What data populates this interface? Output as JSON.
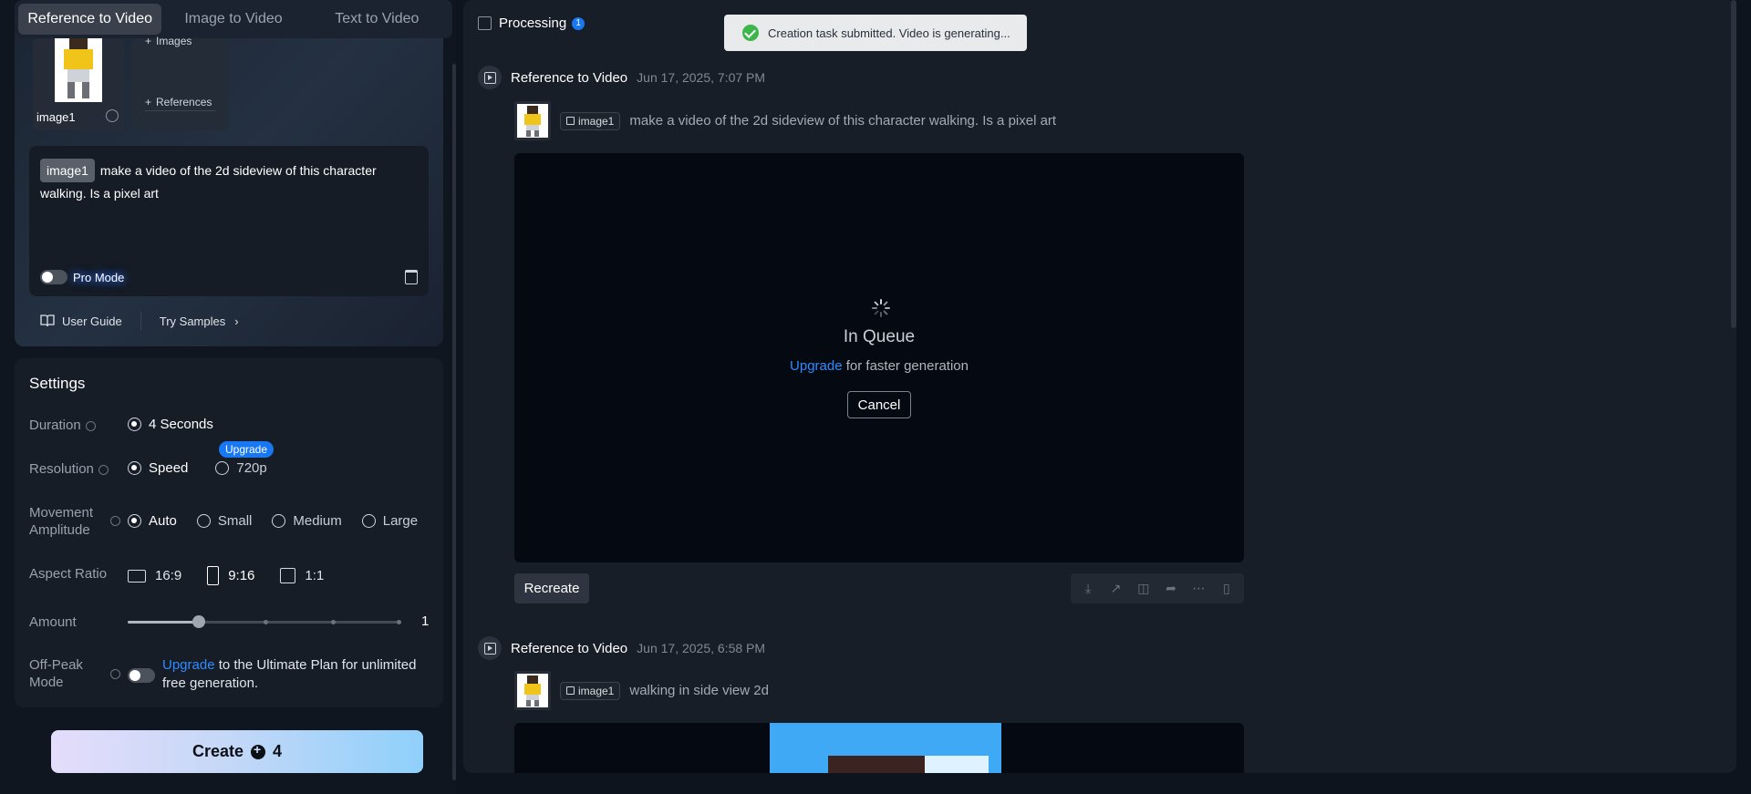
{
  "tabs": [
    "Reference to Video",
    "Image to Video",
    "Text to Video"
  ],
  "reference": {
    "image_label": "image1",
    "add_images": "Images",
    "add_references": "References"
  },
  "prompt": {
    "chip": "image1",
    "text": "make a video of the 2d sideview of this character walking. Is a pixel art",
    "pro_mode": "Pro Mode"
  },
  "links": {
    "user_guide": "User Guide",
    "try_samples": "Try Samples"
  },
  "settings": {
    "title": "Settings",
    "duration": {
      "label": "Duration",
      "options": [
        "4 Seconds"
      ]
    },
    "resolution": {
      "label": "Resolution",
      "options": [
        "Speed",
        "720p"
      ],
      "upgrade_badge": "Upgrade"
    },
    "movement": {
      "label_line1": "Movement",
      "label_line2": "Amplitude",
      "options": [
        "Auto",
        "Small",
        "Medium",
        "Large"
      ]
    },
    "aspect": {
      "label": "Aspect Ratio",
      "options": [
        "16:9",
        "9:16",
        "1:1"
      ]
    },
    "amount": {
      "label": "Amount",
      "value": "1"
    },
    "offpeak": {
      "label_line1": "Off-Peak",
      "label_line2": "Mode",
      "link": "Upgrade",
      "text": " to the Ultimate Plan for unlimited free generation."
    }
  },
  "create": {
    "label": "Create",
    "cost": "4"
  },
  "processing": {
    "label": "Processing",
    "count": "1"
  },
  "toast": "Creation task submitted. Video is generating...",
  "entries": [
    {
      "title": "Reference to Video",
      "date": "Jun 17, 2025, 7:07 PM",
      "tag": "image1",
      "prompt": "make a video of the 2d sideview of this character walking. Is a pixel art",
      "queue_title": "In Queue",
      "queue_link": "Upgrade",
      "queue_text": " for faster generation",
      "cancel": "Cancel",
      "recreate": "Recreate"
    },
    {
      "title": "Reference to Video",
      "date": "Jun 17, 2025, 6:58 PM",
      "tag": "image1",
      "prompt": "walking in side view 2d"
    }
  ],
  "colors": {
    "accent": "#1877f2",
    "link": "#2e8bff",
    "success": "#3cb64a",
    "create_gradient_start": "#e4ddfb",
    "create_gradient_end": "#8fd0fb"
  },
  "icons": [
    "check-circle-icon",
    "play-box-icon",
    "image-tag-icon",
    "trash-icon",
    "book-icon",
    "chevron-right-icon",
    "plus-icon",
    "info-icon",
    "download-icon",
    "share-icon",
    "compare-icon",
    "forward-icon",
    "more-icon",
    "bookmark-icon",
    "spinner-icon",
    "coin-icon"
  ]
}
